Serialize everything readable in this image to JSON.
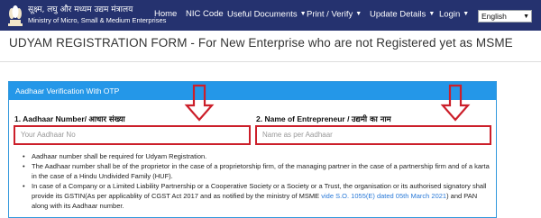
{
  "header": {
    "ministry_hindi": "सूक्ष्म, लघु और मध्यम उद्यम मंत्रालय",
    "ministry_english": "Ministry of Micro, Small & Medium Enterprises",
    "nav": [
      {
        "label": "Home",
        "active": true
      },
      {
        "label": "NIC Code",
        "active": false
      },
      {
        "label": "Useful Documents",
        "active": false
      },
      {
        "label": "Print / Verify",
        "active": false
      },
      {
        "label": "Update Details",
        "active": false
      },
      {
        "label": "Login",
        "active": false
      }
    ],
    "language_selected": "English"
  },
  "page": {
    "title": "UDYAM REGISTRATION FORM - For New Enterprise who are not Registered yet as MSME"
  },
  "form": {
    "section_header": "Aadhaar Verification With OTP",
    "aadhaar_label_en": "1. Aadhaar Number/ ",
    "aadhaar_label_hi": "आधार संख्या",
    "aadhaar_placeholder": "Your Aadhaar No",
    "name_label_en": "2. Name of Entrepreneur / ",
    "name_label_hi": "उद्यमी का नाम",
    "name_placeholder": "Name as per Aadhaar",
    "bullets": {
      "b1": "Aadhaar number shall be required for Udyam Registration.",
      "b2": "The Aadhaar number shall be of the proprietor in the case of a proprietorship firm, of the managing partner in the case of a partnership firm and of a karta in the case of a Hindu Undivided Family (HUF).",
      "b3_pre": "In case of a Company or a Limited Liability Partnership or a Cooperative Society or a Society or a Trust, the organisation or its authorised signatory shall provide its GSTIN(As per applicablity of CGST Act 2017 and as notified by the ministry of MSME ",
      "b3_link": "vide S.O. 1055(E) dated 05th March 2021",
      "b3_post": ") and PAN along with its Aadhaar number."
    }
  },
  "colors": {
    "navbar": "#25326f",
    "card_header": "#2497e8",
    "highlight_red": "#cc1f2a"
  }
}
